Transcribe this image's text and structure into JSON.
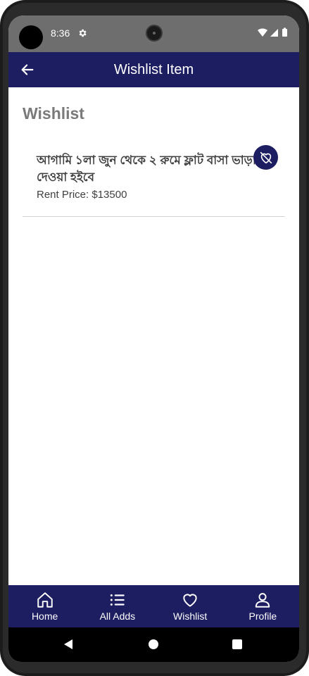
{
  "status_bar": {
    "time": "8:36",
    "settings_icon": "gear-icon",
    "wifi_icon": "wifi-icon",
    "signal_icon": "signal-icon",
    "battery_icon": "battery-icon"
  },
  "app_bar": {
    "title": "Wishlist Item",
    "back_icon": "arrow-left-icon"
  },
  "page": {
    "section_title": "Wishlist"
  },
  "wishlist": {
    "items": [
      {
        "title": "আগামি ১লা জুন থেকে ২ রুমে ফ্লাট বাসা ভাড়া দেওয়া  হইবে",
        "price": "Rent Price: $13500",
        "action_icon": "heart-off-icon"
      }
    ]
  },
  "bottom_nav": {
    "items": [
      {
        "label": "Home",
        "icon": "home-icon"
      },
      {
        "label": "All Adds",
        "icon": "list-icon"
      },
      {
        "label": "Wishlist",
        "icon": "heart-icon"
      },
      {
        "label": "Profile",
        "icon": "person-icon"
      }
    ]
  },
  "colors": {
    "primary": "#1d1d62",
    "status_bar": "#6e6e6e",
    "section_title": "#7a7a7a",
    "text": "#3f3f3f"
  }
}
